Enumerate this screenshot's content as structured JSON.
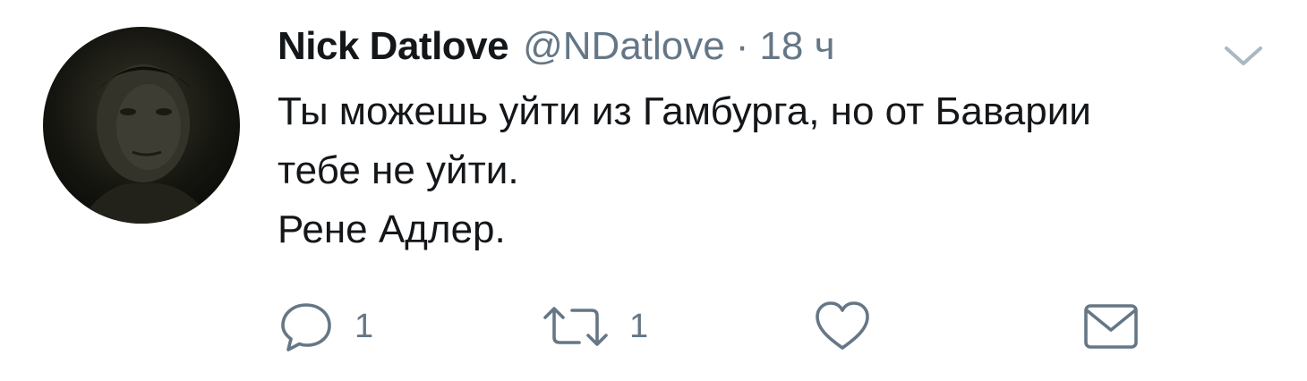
{
  "tweet": {
    "author_name": "Nick Datlove",
    "handle": "@NDatlove",
    "separator": "·",
    "time": "18 ч",
    "lines": [
      "Ты можешь уйти из Гамбурга, но от Баварии",
      "тебе не уйти.",
      "Рене Адлер."
    ]
  },
  "actions": {
    "reply": {
      "icon": "reply-icon",
      "count": "1"
    },
    "retweet": {
      "icon": "retweet-icon",
      "count": "1"
    },
    "like": {
      "icon": "heart-icon"
    },
    "message": {
      "icon": "envelope-icon"
    }
  },
  "menu": {
    "icon": "chevron-down-icon"
  },
  "colors": {
    "text": "#14171a",
    "secondary": "#657786",
    "background": "#ffffff"
  }
}
